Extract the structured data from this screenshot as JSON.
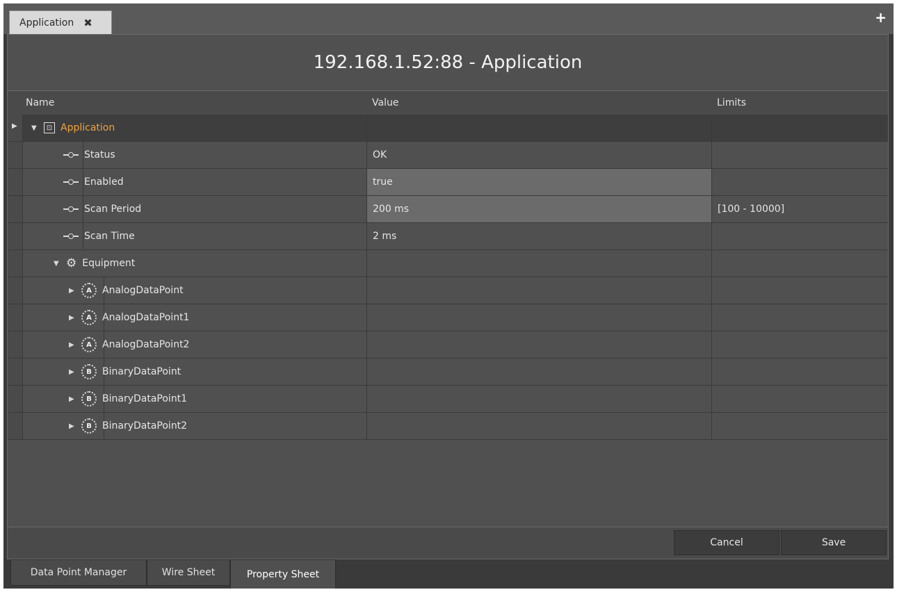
{
  "document_tab": {
    "label": "Application",
    "close_glyph": "✖"
  },
  "add_tab_glyph": "+",
  "panel_title": "192.168.1.52:88 - Application",
  "columns": {
    "name": "Name",
    "value": "Value",
    "limits": "Limits"
  },
  "rows": [
    {
      "name": "Application",
      "value": "",
      "limits": ""
    },
    {
      "name": "Status",
      "value": "OK",
      "limits": ""
    },
    {
      "name": "Enabled",
      "value": "true",
      "limits": ""
    },
    {
      "name": "Scan Period",
      "value": "200 ms",
      "limits": "[100 - 10000]"
    },
    {
      "name": "Scan Time",
      "value": "2 ms",
      "limits": ""
    },
    {
      "name": "Equipment",
      "value": "",
      "limits": ""
    },
    {
      "name": "AnalogDataPoint",
      "value": "",
      "limits": "",
      "badge": "A"
    },
    {
      "name": "AnalogDataPoint1",
      "value": "",
      "limits": "",
      "badge": "A"
    },
    {
      "name": "AnalogDataPoint2",
      "value": "",
      "limits": "",
      "badge": "A"
    },
    {
      "name": "BinaryDataPoint",
      "value": "",
      "limits": "",
      "badge": "B"
    },
    {
      "name": "BinaryDataPoint1",
      "value": "",
      "limits": "",
      "badge": "B"
    },
    {
      "name": "BinaryDataPoint2",
      "value": "",
      "limits": "",
      "badge": "B"
    }
  ],
  "buttons": {
    "cancel": "Cancel",
    "save": "Save"
  },
  "bottom_tabs": [
    "Data Point Manager",
    "Wire Sheet",
    "Property Sheet"
  ],
  "active_bottom_tab": "Property Sheet",
  "colors": {
    "accent_orange": "#f0a23c",
    "panel_bg": "#505050",
    "selected_row_bg": "#3e3e3e"
  }
}
